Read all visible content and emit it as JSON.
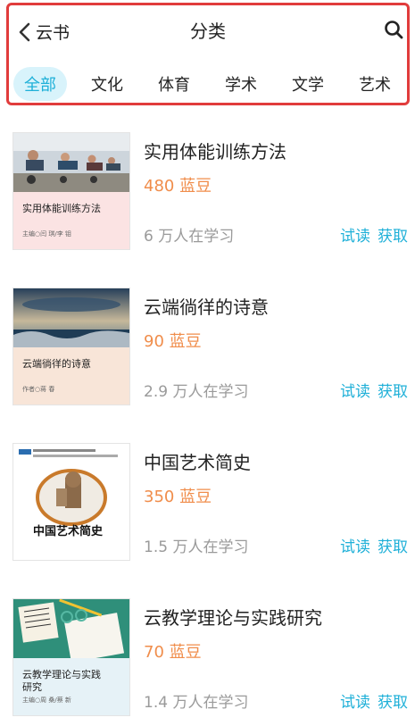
{
  "header": {
    "back_label": "云书",
    "title": "分类"
  },
  "tabs": [
    {
      "label": "全部",
      "active": true
    },
    {
      "label": "文化",
      "active": false
    },
    {
      "label": "体育",
      "active": false
    },
    {
      "label": "学术",
      "active": false
    },
    {
      "label": "文学",
      "active": false
    },
    {
      "label": "艺术",
      "active": false
    }
  ],
  "books": [
    {
      "name": "实用体能训练方法",
      "price": "480 蓝豆",
      "learners": "6 万人在学习",
      "trial_label": "试读",
      "get_label": "获取",
      "cover_title": "实用体能训练方法",
      "cover_author": "主编○闫  琪/李  钼",
      "cover_panel_color": "#fbe3e3"
    },
    {
      "name": "云端徜徉的诗意",
      "price": "90 蓝豆",
      "learners": "2.9 万人在学习",
      "trial_label": "试读",
      "get_label": "获取",
      "cover_title": "云端徜徉的诗意",
      "cover_author": "作者○蒋  春",
      "cover_panel_color": "#f8e5d8"
    },
    {
      "name": "中国艺术简史",
      "price": "350 蓝豆",
      "learners": "1.5 万人在学习",
      "trial_label": "试读",
      "get_label": "获取",
      "cover_title": "中国艺术简史",
      "cover_author": "",
      "cover_panel_color": "#ffffff"
    },
    {
      "name": "云教学理论与实践研究",
      "price": "70 蓝豆",
      "learners": "1.4 万人在学习",
      "trial_label": "试读",
      "get_label": "获取",
      "cover_title": "云教学理论与实践研究",
      "cover_author": "主编○周  桑/蔡  新",
      "cover_panel_color": "#e6f2f7"
    }
  ],
  "colors": {
    "accent": "#1fb0d8",
    "price": "#f08d4b",
    "muted": "#9a9a9a",
    "highlight_border": "#e13c3c"
  }
}
